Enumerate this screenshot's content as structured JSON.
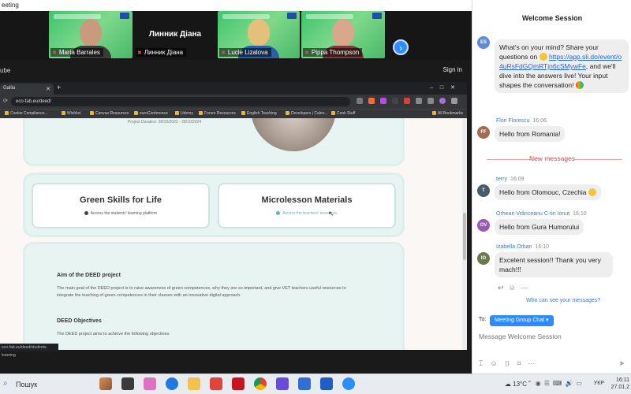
{
  "meeting": {
    "title_partial": "eeting",
    "participants": [
      {
        "name": "Maria Barrales",
        "muted": true
      },
      {
        "name": "Линник Діана",
        "muted": true
      },
      {
        "name": "Lucie Lizalova",
        "muted": true
      },
      {
        "name": "Pippa Thompson",
        "muted": true
      }
    ],
    "center_tile_name": "Линник Діана",
    "left_label_partial": "ube",
    "sign_in": "Sign in"
  },
  "browser": {
    "tab_title": "Gallia",
    "url": "eco-fab.eu/deed/",
    "bookmarks": [
      "Cookie Compliance...",
      "Wishlist",
      "Canvas Resources",
      "euroConference",
      "Udemy",
      "Forum Resources",
      "English Teaching",
      "Developers | Calen...",
      "Cook Stuff",
      "All Bookmarks"
    ],
    "status_text": "eco-fab.eu/deed/students-learning"
  },
  "page": {
    "project_duration": "Project Duration: 28/10/2022 - 28/10/2024",
    "card_green": {
      "title": "Green Skills for Life",
      "sub": "Access the students' learning platform"
    },
    "card_micro": {
      "title": "Microlesson Materials",
      "sub": "Access the teachers' resources"
    },
    "aim_heading": "Aim of the DEED project",
    "aim_text": "The main goal of the DEED project is to raise awareness of green competences, why they are so important, and give VET teachers useful resources to integrate the teaching of green competences in their classes with an innovative digital approach.",
    "objectives_heading": "DEED Objectives",
    "objectives_text": "The DEED project aims to achieve the following objectives:"
  },
  "chat": {
    "title": "Welcome Session",
    "messages": [
      {
        "initials": "ES",
        "avatar_color": "#5b8bd9",
        "sender": "",
        "time": "",
        "text_before": "What's on your mind? Share your questions on",
        "link": "https://app.sli.do/event/o4uRsFdGQmRTjn6cSMywFe",
        "text_after": ", and we'll dive into the answers live! Your input shapes the conversation!"
      },
      {
        "initials": "FF",
        "avatar_color": "#a36a4f",
        "sender": "Flori Florescu",
        "time": "16:06",
        "text": "Hello from Romania!"
      },
      {
        "initials": "T",
        "avatar_color": "#4a5a6a",
        "sender": "terry",
        "time": "16:09",
        "text": "Hello from Olomouc, Czechia"
      },
      {
        "initials": "OV",
        "avatar_color": "#9b59b6",
        "sender": "Orhean Vrânceanu C-tin Ionut",
        "time": "16:10",
        "text": "Hello from Gura Humorului"
      },
      {
        "initials": "IO",
        "avatar_color": "#6b7a4a",
        "sender": "Izabella Orban",
        "time": "16:10",
        "text": "Excelent session!! Thank you very mach!!!"
      }
    ],
    "new_messages_label": "New messages",
    "who_can_see": "Who can see your messages?",
    "to_label": "To:",
    "to_recipient": "Meeting Group Chat",
    "input_placeholder": "Message Welcome Session"
  },
  "taskbar": {
    "search_label": "Пошук",
    "weather": "13°C",
    "language": "УКР",
    "time": "16:11",
    "date": "27.01.2"
  },
  "colors": {
    "zoom_blue": "#2d8cff",
    "link_blue": "#2166d4",
    "new_messages_red": "#e04545",
    "tile_green": "#49b86a"
  }
}
